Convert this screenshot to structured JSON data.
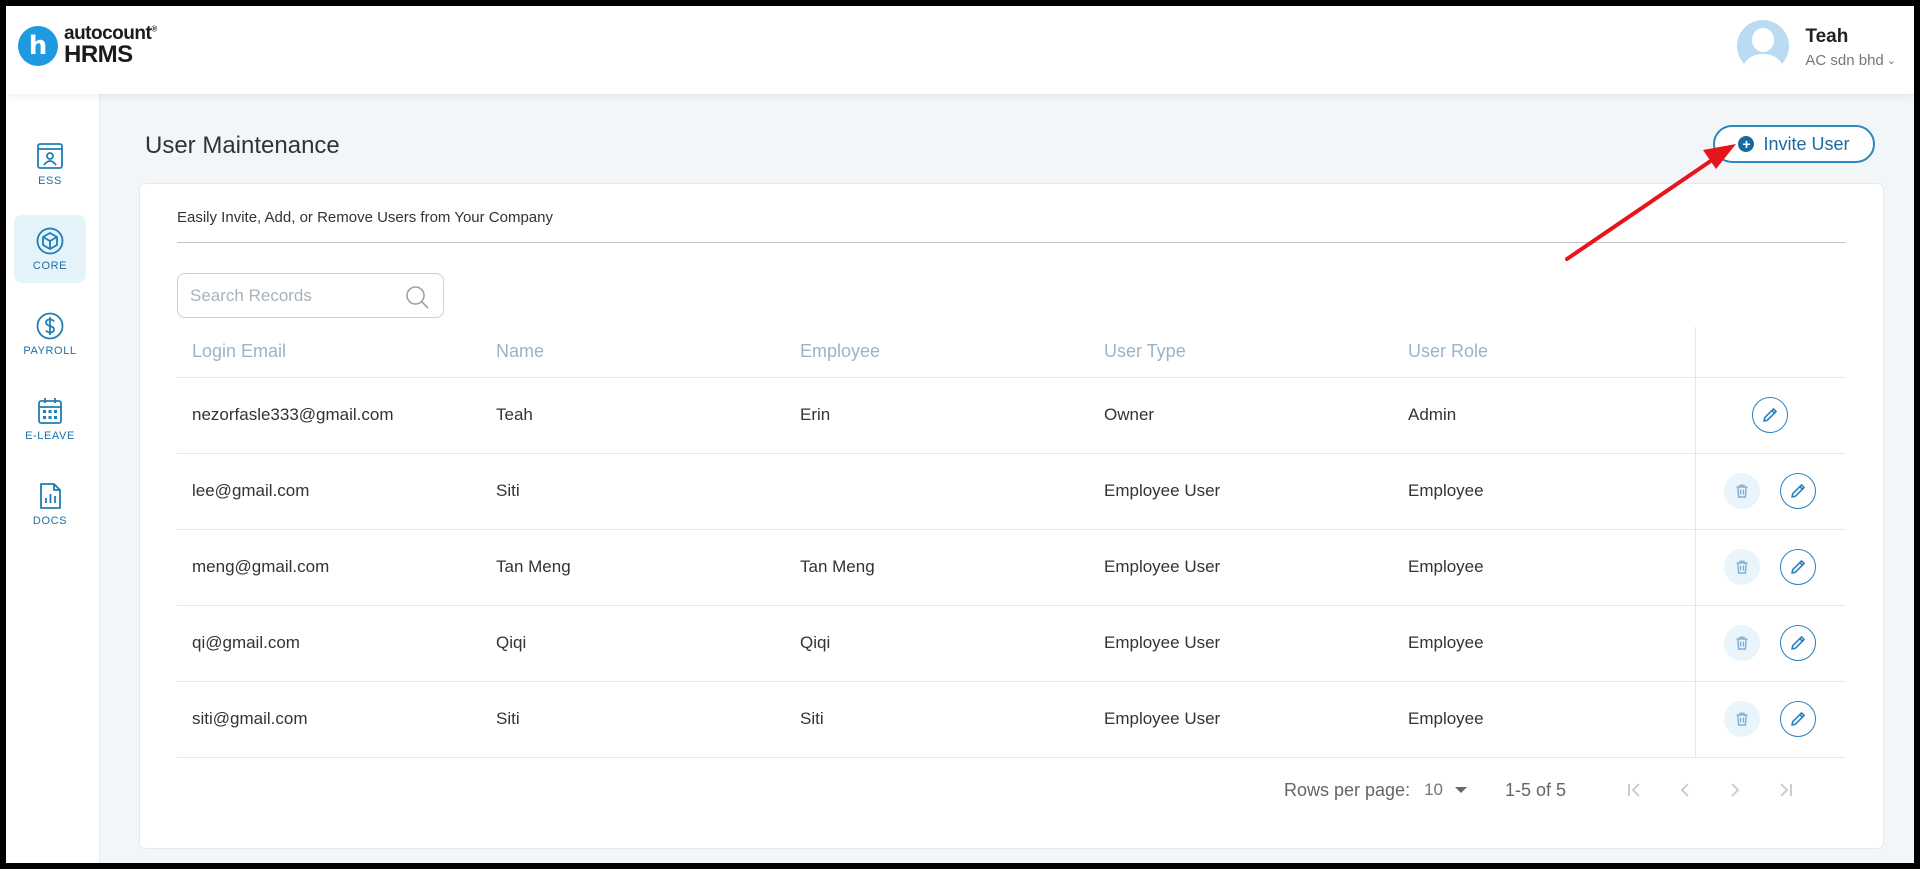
{
  "app": {
    "logo_letter": "h",
    "logo_top": "autocount",
    "logo_reg": "®",
    "logo_bottom": "HRMS"
  },
  "user": {
    "name": "Teah",
    "company": "AC sdn bhd"
  },
  "sidebar": {
    "items": [
      {
        "label": "ESS",
        "icon": "ess-icon",
        "active": false
      },
      {
        "label": "CORE",
        "icon": "cube-icon",
        "active": true
      },
      {
        "label": "PAYROLL",
        "icon": "dollar-icon",
        "active": false
      },
      {
        "label": "E-LEAVE",
        "icon": "calendar-icon",
        "active": false
      },
      {
        "label": "DOCS",
        "icon": "document-chart-icon",
        "active": false
      }
    ]
  },
  "page": {
    "title": "User Maintenance",
    "invite_label": "Invite User",
    "subtitle": "Easily Invite, Add, or Remove Users from Your Company",
    "search_placeholder": "Search Records"
  },
  "table": {
    "columns": [
      "Login Email",
      "Name",
      "Employee",
      "User Type",
      "User Role"
    ],
    "rows": [
      {
        "email": "nezorfasle333@gmail.com",
        "name": "Teah",
        "employee": "Erin",
        "type": "Owner",
        "role": "Admin",
        "deletable": false
      },
      {
        "email": "lee@gmail.com",
        "name": "Siti",
        "employee": "",
        "type": "Employee User",
        "role": "Employee",
        "deletable": true
      },
      {
        "email": "meng@gmail.com",
        "name": "Tan Meng",
        "employee": "Tan Meng",
        "type": "Employee User",
        "role": "Employee",
        "deletable": true
      },
      {
        "email": "qi@gmail.com",
        "name": "Qiqi",
        "employee": "Qiqi",
        "type": "Employee User",
        "role": "Employee",
        "deletable": true
      },
      {
        "email": "siti@gmail.com",
        "name": "Siti",
        "employee": "Siti",
        "type": "Employee User",
        "role": "Employee",
        "deletable": true
      }
    ]
  },
  "pagination": {
    "rows_per_page_label": "Rows per page:",
    "rows_per_page": "10",
    "range": "1-5 of 5"
  },
  "colors": {
    "accent": "#1a6aa1",
    "annotation_arrow": "#e8141c"
  }
}
